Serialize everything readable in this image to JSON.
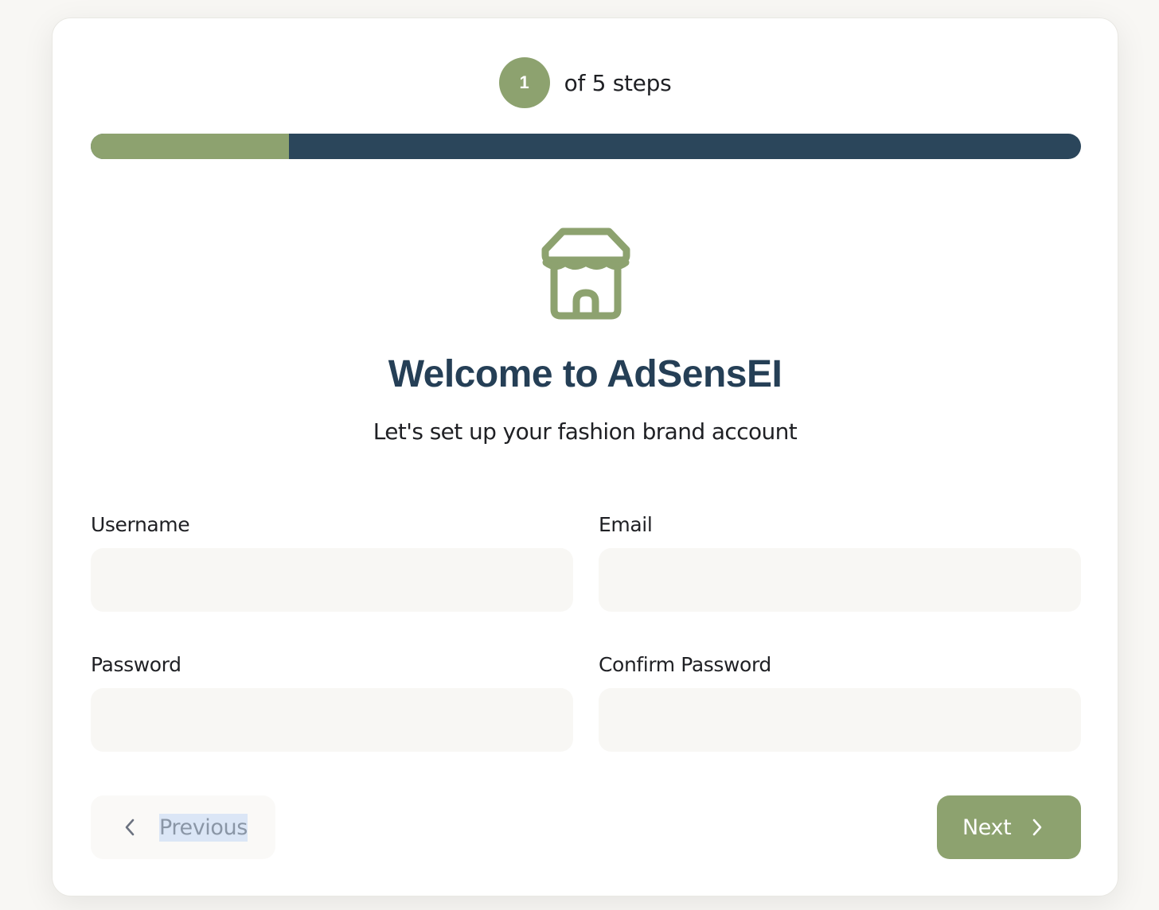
{
  "stepper": {
    "current_step": "1",
    "steps_text": "of 5 steps",
    "progress_fraction": 0.2
  },
  "colors": {
    "accent": "#8da26f",
    "progress_track": "#2b465b",
    "title": "#253f56",
    "input_bg": "#f8f7f4"
  },
  "hero": {
    "icon": "store-icon",
    "title": "Welcome to AdSensEI",
    "subtitle": "Let's set up your fashion brand account"
  },
  "form": {
    "username": {
      "label": "Username",
      "value": ""
    },
    "email": {
      "label": "Email",
      "value": ""
    },
    "password": {
      "label": "Password",
      "value": ""
    },
    "confirm_password": {
      "label": "Confirm Password",
      "value": ""
    }
  },
  "nav": {
    "previous_label": "Previous",
    "previous_icon": "chevron-left-icon",
    "next_label": "Next",
    "next_icon": "chevron-right-icon"
  }
}
